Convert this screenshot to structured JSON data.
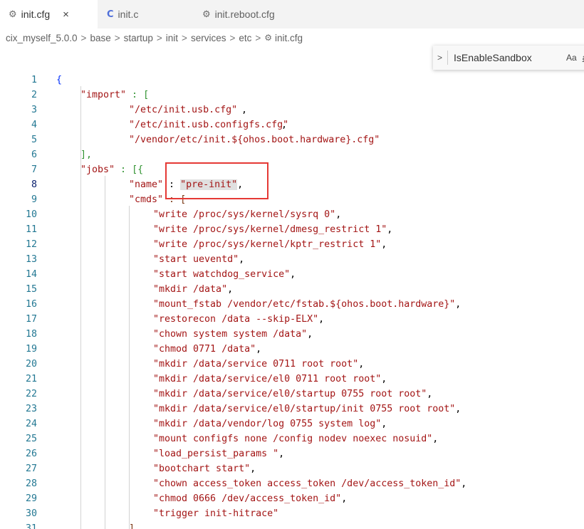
{
  "tabs": [
    {
      "icon": "gear-icon",
      "label": "init.cfg",
      "active": true,
      "close": "×"
    },
    {
      "icon": "c-file-icon",
      "label": "init.c",
      "active": false
    },
    {
      "icon": "gear-icon",
      "label": "init.reboot.cfg",
      "active": false
    }
  ],
  "breadcrumb": [
    "cix_myself_5.0.0",
    "base",
    "startup",
    "init",
    "services",
    "etc",
    "init.cfg"
  ],
  "find": {
    "query": "IsEnableSandbox",
    "match_case": "Aa",
    "whole_word": "ab"
  },
  "code": {
    "line_numbers": [
      "1",
      "2",
      "3",
      "4",
      "5",
      "6",
      "7",
      "8",
      "9",
      "10",
      "11",
      "12",
      "13",
      "14",
      "15",
      "16",
      "17",
      "18",
      "19",
      "20",
      "21",
      "22",
      "23",
      "24",
      "25",
      "26",
      "27",
      "28",
      "29",
      "30",
      "31"
    ],
    "l1": "{",
    "l2_key": "\"import\"",
    "l2_rest": " : [",
    "l3": "\"/etc/init.usb.cfg\"",
    "l4": "\"/etc/init.usb.configfs.cfg\"",
    "l5": "\"/vendor/etc/init.${ohos.boot.hardware}.cfg\"",
    "l6": "],",
    "l7_key": "\"jobs\"",
    "l7_rest": " : [{",
    "l8_key": "\"name\"",
    "l8_val": "\"pre-init\"",
    "l9_key": "\"cmds\"",
    "l9_rest": " : [",
    "cmds": [
      "\"write /proc/sys/kernel/sysrq 0\"",
      "\"write /proc/sys/kernel/dmesg_restrict 1\"",
      "\"write /proc/sys/kernel/kptr_restrict 1\"",
      "\"start ueventd\"",
      "\"start watchdog_service\"",
      "\"mkdir /data\"",
      "\"mount_fstab /vendor/etc/fstab.${ohos.boot.hardware}\"",
      "\"restorecon /data --skip-ELX\"",
      "\"chown system system /data\"",
      "\"chmod 0771 /data\"",
      "\"mkdir /data/service 0711 root root\"",
      "\"mkdir /data/service/el0 0711 root root\"",
      "\"mkdir /data/service/el0/startup 0755 root root\"",
      "\"mkdir /data/service/el0/startup/init 0755 root root\"",
      "\"mkdir /data/vendor/log 0755 system log\"",
      "\"mount configfs none /config nodev noexec nosuid\"",
      "\"load_persist_params \"",
      "\"bootchart start\"",
      "\"chown access_token access_token /dev/access_token_id\"",
      "\"chmod 0666 /dev/access_token_id\"",
      "\"trigger init-hitrace\""
    ],
    "l31": "]"
  },
  "colors": {
    "string": "#a31515",
    "line_number": "#237893",
    "brace": "#0431fa",
    "highlight_box": "#e53935"
  }
}
